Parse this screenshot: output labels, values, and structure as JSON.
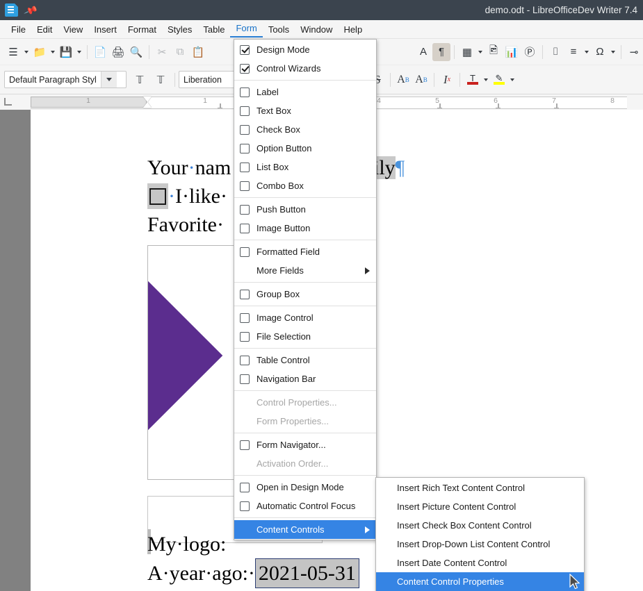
{
  "window": {
    "title": "demo.odt - LibreOfficeDev Writer 7.4",
    "app_icon": "writer-document-icon",
    "pin_icon": "pin-icon"
  },
  "menubar": {
    "items": [
      {
        "label": "File",
        "active": false
      },
      {
        "label": "Edit",
        "active": false
      },
      {
        "label": "View",
        "active": false
      },
      {
        "label": "Insert",
        "active": false
      },
      {
        "label": "Format",
        "active": false
      },
      {
        "label": "Styles",
        "active": false
      },
      {
        "label": "Table",
        "active": false
      },
      {
        "label": "Form",
        "active": true
      },
      {
        "label": "Tools",
        "active": false
      },
      {
        "label": "Window",
        "active": false
      },
      {
        "label": "Help",
        "active": false
      }
    ]
  },
  "toolbar_standard": {
    "buttons": [
      {
        "name": "new-document",
        "glyph": "☰",
        "caret": true
      },
      {
        "name": "open-document",
        "glyph": "📁",
        "caret": true
      },
      {
        "name": "save-document",
        "glyph": "💾",
        "caret": true
      },
      {
        "name": "export-pdf",
        "glyph": "📄"
      },
      {
        "name": "print",
        "glyph": "🖨"
      },
      {
        "name": "print-preview",
        "glyph": "🔍"
      },
      {
        "name": "cut",
        "glyph": "✂",
        "dim": true
      },
      {
        "name": "copy",
        "glyph": "⧉",
        "dim": true
      },
      {
        "name": "paste",
        "glyph": "📋",
        "dim": true
      }
    ],
    "right_buttons": [
      {
        "name": "formatting-marks-A",
        "glyph": "A"
      },
      {
        "name": "formatting-marks",
        "glyph": "¶",
        "pressed": true
      },
      {
        "name": "insert-table",
        "glyph": "▦",
        "caret": true
      },
      {
        "name": "insert-image",
        "glyph": "🖼"
      },
      {
        "name": "insert-chart",
        "glyph": "📊"
      },
      {
        "name": "insert-text-box",
        "glyph": "Ⓣ"
      },
      {
        "name": "insert-page-break",
        "glyph": "⌷"
      },
      {
        "name": "insert-field",
        "glyph": "≡",
        "caret": true
      },
      {
        "name": "insert-special-character",
        "glyph": "Ω",
        "caret": true
      },
      {
        "name": "insert-hyperlink",
        "glyph": "🔗"
      }
    ]
  },
  "toolbar_formatting": {
    "paragraph_style": "Default Paragraph Styl",
    "font_name": "Liberation",
    "font_size": "",
    "buttons": [
      {
        "name": "set-paragraph-style",
        "glyph": "T"
      },
      {
        "name": "clone-paragraph-style",
        "glyph": "T"
      },
      {
        "name": "bold",
        "glyph": "B"
      },
      {
        "name": "italic",
        "glyph": "I"
      },
      {
        "name": "underline",
        "glyph": "U",
        "caret": true
      },
      {
        "name": "strikethrough",
        "glyph": "S"
      },
      {
        "name": "superscript",
        "glyph": "A"
      },
      {
        "name": "subscript",
        "glyph": "A"
      },
      {
        "name": "clear-formatting",
        "glyph": "I"
      },
      {
        "name": "font-color",
        "glyph": "T",
        "caret": true
      },
      {
        "name": "highlight-color",
        "glyph": "✎",
        "caret": true
      }
    ]
  },
  "ruler": {
    "numbers": [
      "1",
      "1",
      "4",
      "5",
      "6",
      "7",
      "8"
    ]
  },
  "document": {
    "line1_prefix": "Your",
    "line1_mid": "nam",
    "line1_tail": "nily",
    "line1_pilcrow": "¶",
    "line2_text": "I·like·",
    "line3_text": "Favorite·",
    "line_logo": "My·logo:",
    "line_year": "A·year·ago:·",
    "date_value": "2021-05-31"
  },
  "form_menu": {
    "items": [
      {
        "label": "Design Mode",
        "type": "check",
        "checked": true
      },
      {
        "label": "Control Wizards",
        "type": "check",
        "checked": true
      },
      {
        "type": "separator"
      },
      {
        "label": "Label",
        "type": "check",
        "checked": false
      },
      {
        "label": "Text Box",
        "type": "check",
        "checked": false
      },
      {
        "label": "Check Box",
        "type": "check",
        "checked": false
      },
      {
        "label": "Option Button",
        "type": "check",
        "checked": false
      },
      {
        "label": "List Box",
        "type": "check",
        "checked": false
      },
      {
        "label": "Combo Box",
        "type": "check",
        "checked": false
      },
      {
        "type": "separator"
      },
      {
        "label": "Push Button",
        "type": "check",
        "checked": false
      },
      {
        "label": "Image Button",
        "type": "check",
        "checked": false
      },
      {
        "type": "separator"
      },
      {
        "label": "Formatted Field",
        "type": "check",
        "checked": false
      },
      {
        "label": "More Fields",
        "type": "submenu"
      },
      {
        "type": "separator"
      },
      {
        "label": "Group Box",
        "type": "check",
        "checked": false
      },
      {
        "type": "separator"
      },
      {
        "label": "Image Control",
        "type": "check",
        "checked": false
      },
      {
        "label": "File Selection",
        "type": "check",
        "checked": false
      },
      {
        "type": "separator"
      },
      {
        "label": "Table Control",
        "type": "check",
        "checked": false
      },
      {
        "label": "Navigation Bar",
        "type": "check",
        "checked": false
      },
      {
        "type": "separator"
      },
      {
        "label": "Control Properties...",
        "type": "plain",
        "disabled": true
      },
      {
        "label": "Form Properties...",
        "type": "plain",
        "disabled": true
      },
      {
        "type": "separator"
      },
      {
        "label": "Form Navigator...",
        "type": "check",
        "checked": false
      },
      {
        "label": "Activation Order...",
        "type": "plain",
        "disabled": true
      },
      {
        "type": "separator"
      },
      {
        "label": "Open in Design Mode",
        "type": "check",
        "checked": false
      },
      {
        "label": "Automatic Control Focus",
        "type": "check",
        "checked": false
      },
      {
        "type": "separator"
      },
      {
        "label": "Content Controls",
        "type": "submenu",
        "highlighted": true
      }
    ]
  },
  "content_controls_submenu": {
    "items": [
      {
        "label": "Insert Rich Text Content Control",
        "highlighted": false
      },
      {
        "label": "Insert Picture Content Control",
        "highlighted": false
      },
      {
        "label": "Insert Check Box Content Control",
        "highlighted": false
      },
      {
        "label": "Insert Drop-Down List Content Control",
        "highlighted": false
      },
      {
        "label": "Insert Date Content Control",
        "highlighted": false
      },
      {
        "label": "Content Control Properties",
        "highlighted": true
      }
    ]
  },
  "colors": {
    "titlebar": "#3b444e",
    "menu_highlight": "#3584e4",
    "accent": "#2a7fd4",
    "logo_purple": "#5b2d8e",
    "field_gray": "#c4c4c4"
  },
  "cursor": {
    "icon": "mouse-pointer-icon"
  }
}
